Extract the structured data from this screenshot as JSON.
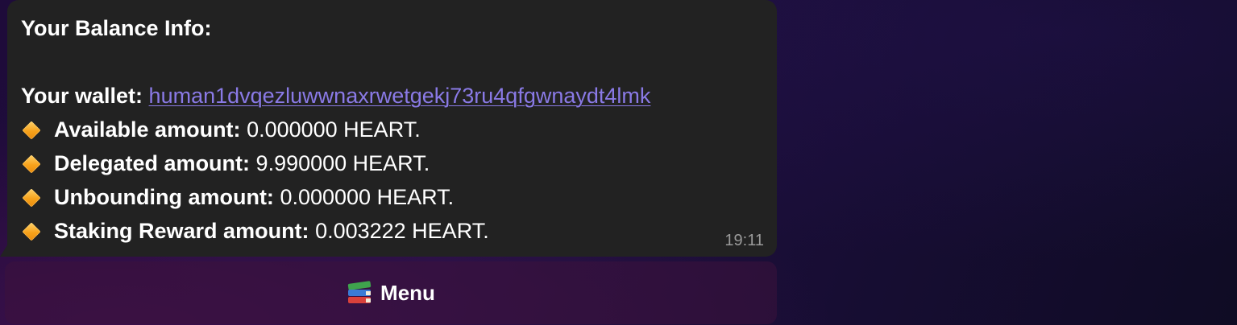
{
  "message": {
    "title": "Your Balance Info:",
    "wallet_label": "Your wallet:",
    "wallet_address": "human1dvqezluwwnaxrwetgekj73ru4qfgwnaydt4lmk",
    "items": [
      {
        "label": "Available amount:",
        "value": "0.000000 HEART.",
        "icon": "orange-diamond-icon"
      },
      {
        "label": "Delegated amount:",
        "value": "9.990000 HEART.",
        "icon": "orange-diamond-icon"
      },
      {
        "label": "Unbounding amount:",
        "value": "0.000000 HEART.",
        "icon": "orange-diamond-icon"
      },
      {
        "label": "Staking Reward amount:",
        "value": "0.003222 HEART.",
        "icon": "orange-diamond-icon"
      }
    ],
    "time": "19:11"
  },
  "keyboard": {
    "menu_label": "Menu",
    "menu_icon": "books-icon"
  },
  "colors": {
    "bubble": "#222222",
    "link": "#8a7ae6",
    "diamond": "#f7a21b",
    "timestamp": "#9a9a9a"
  }
}
